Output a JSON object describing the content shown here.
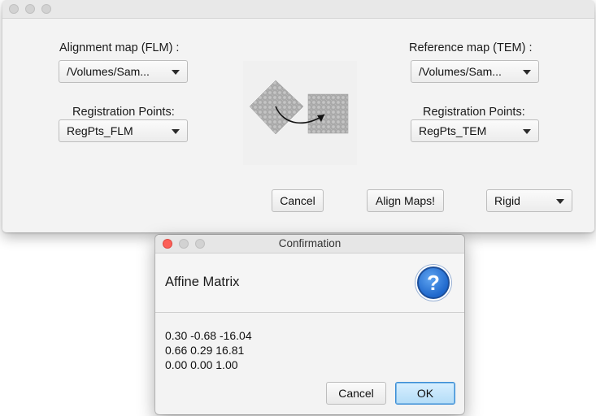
{
  "main": {
    "left_panel": {
      "title": "Alignment map (FLM) :",
      "map_value": "/Volumes/Sam...",
      "reg_label": "Registration Points:",
      "reg_value": "RegPts_FLM"
    },
    "right_panel": {
      "title": "Reference map (TEM) :",
      "map_value": "/Volumes/Sam...",
      "reg_label": "Registration Points:",
      "reg_value": "RegPts_TEM"
    },
    "buttons": {
      "cancel": "Cancel",
      "align": "Align Maps!"
    },
    "transform_select": "Rigid"
  },
  "dialog": {
    "title": "Confirmation",
    "header": "Affine Matrix",
    "icon": "question-icon",
    "matrix_rows": [
      "0.30 -0.68 -16.04",
      "0.66 0.29 16.81",
      "0.00 0.00 1.00"
    ],
    "cancel_label": "Cancel",
    "ok_label": "OK"
  },
  "colors": {
    "close_red": "#fc5f57",
    "traffic_inactive": "#d2d2d2",
    "info_icon_blue": "#1f68cc",
    "default_button_blue": "#b3dcf7"
  }
}
